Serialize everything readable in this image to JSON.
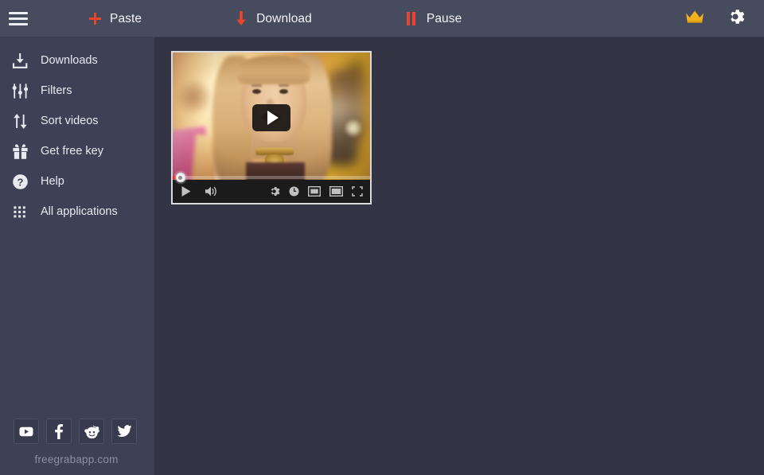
{
  "app": {
    "site_url": "freegrabapp.com"
  },
  "toolbar": {
    "menu_icon": "hamburger-menu-icon",
    "buttons": [
      {
        "label": "Paste",
        "icon": "plus-icon",
        "icon_color": "#e8452a"
      },
      {
        "label": "Download",
        "icon": "download-arrow-icon",
        "icon_color": "#e8452a"
      },
      {
        "label": "Pause",
        "icon": "pause-bars-icon",
        "icon_color": "#e8452a"
      }
    ],
    "right": [
      {
        "name": "premium-crown",
        "icon": "crown-icon",
        "color": "#f2b01e"
      },
      {
        "name": "settings",
        "icon": "gear-icon",
        "color": "#ffffff"
      }
    ]
  },
  "sidebar": {
    "items": [
      {
        "label": "Downloads",
        "icon": "download-tray-icon"
      },
      {
        "label": "Filters",
        "icon": "sliders-icon"
      },
      {
        "label": "Sort videos",
        "icon": "sort-arrows-icon"
      },
      {
        "label": "Get free key",
        "icon": "gift-icon"
      },
      {
        "label": "Help",
        "icon": "question-circle-icon"
      },
      {
        "label": "All applications",
        "icon": "grid-dots-icon"
      }
    ],
    "social": [
      {
        "name": "youtube",
        "icon": "youtube-icon"
      },
      {
        "name": "facebook",
        "icon": "facebook-icon"
      },
      {
        "name": "reddit",
        "icon": "reddit-icon"
      },
      {
        "name": "twitter",
        "icon": "twitter-icon"
      }
    ]
  },
  "player": {
    "play_overlay_icon": "play-triangle-icon",
    "progress_percent": 4,
    "controls_left": [
      {
        "name": "play",
        "icon": "play-icon"
      },
      {
        "name": "volume",
        "icon": "speaker-icon"
      }
    ],
    "controls_right": [
      {
        "name": "settings",
        "icon": "gear-icon"
      },
      {
        "name": "watch-later",
        "icon": "clock-circle-icon"
      },
      {
        "name": "miniplayer",
        "icon": "miniplayer-icon"
      },
      {
        "name": "theater-mode",
        "icon": "theater-icon"
      },
      {
        "name": "fullscreen",
        "icon": "fullscreen-icon"
      }
    ]
  },
  "colors": {
    "toolbar_bg": "#474b5e",
    "sidebar_bg": "#3e4055",
    "main_bg": "#333545",
    "accent_red": "#e8452a",
    "crown_gold": "#f2b01e",
    "progress_red": "#e62117"
  }
}
